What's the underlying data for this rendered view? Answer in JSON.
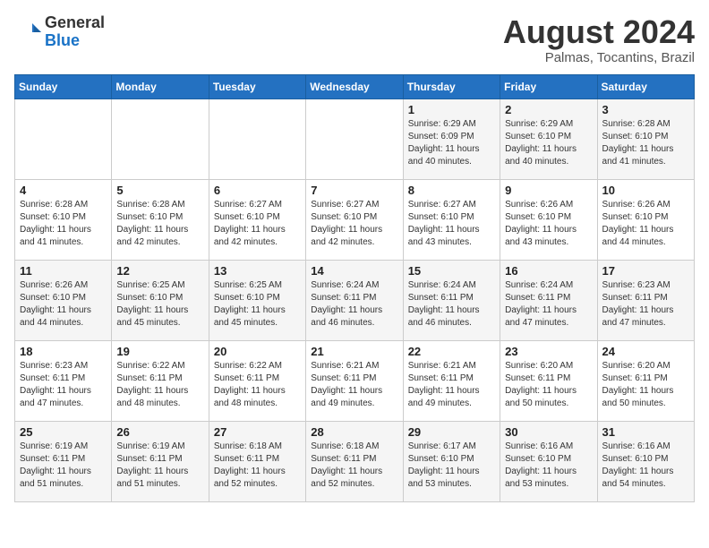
{
  "header": {
    "logo_general": "General",
    "logo_blue": "Blue",
    "month_year": "August 2024",
    "location": "Palmas, Tocantins, Brazil"
  },
  "days_of_week": [
    "Sunday",
    "Monday",
    "Tuesday",
    "Wednesday",
    "Thursday",
    "Friday",
    "Saturday"
  ],
  "weeks": [
    [
      {
        "day": "",
        "sunrise": "",
        "sunset": "",
        "daylight": ""
      },
      {
        "day": "",
        "sunrise": "",
        "sunset": "",
        "daylight": ""
      },
      {
        "day": "",
        "sunrise": "",
        "sunset": "",
        "daylight": ""
      },
      {
        "day": "",
        "sunrise": "",
        "sunset": "",
        "daylight": ""
      },
      {
        "day": "1",
        "sunrise": "Sunrise: 6:29 AM",
        "sunset": "Sunset: 6:09 PM",
        "daylight": "Daylight: 11 hours and 40 minutes."
      },
      {
        "day": "2",
        "sunrise": "Sunrise: 6:29 AM",
        "sunset": "Sunset: 6:10 PM",
        "daylight": "Daylight: 11 hours and 40 minutes."
      },
      {
        "day": "3",
        "sunrise": "Sunrise: 6:28 AM",
        "sunset": "Sunset: 6:10 PM",
        "daylight": "Daylight: 11 hours and 41 minutes."
      }
    ],
    [
      {
        "day": "4",
        "sunrise": "Sunrise: 6:28 AM",
        "sunset": "Sunset: 6:10 PM",
        "daylight": "Daylight: 11 hours and 41 minutes."
      },
      {
        "day": "5",
        "sunrise": "Sunrise: 6:28 AM",
        "sunset": "Sunset: 6:10 PM",
        "daylight": "Daylight: 11 hours and 42 minutes."
      },
      {
        "day": "6",
        "sunrise": "Sunrise: 6:27 AM",
        "sunset": "Sunset: 6:10 PM",
        "daylight": "Daylight: 11 hours and 42 minutes."
      },
      {
        "day": "7",
        "sunrise": "Sunrise: 6:27 AM",
        "sunset": "Sunset: 6:10 PM",
        "daylight": "Daylight: 11 hours and 42 minutes."
      },
      {
        "day": "8",
        "sunrise": "Sunrise: 6:27 AM",
        "sunset": "Sunset: 6:10 PM",
        "daylight": "Daylight: 11 hours and 43 minutes."
      },
      {
        "day": "9",
        "sunrise": "Sunrise: 6:26 AM",
        "sunset": "Sunset: 6:10 PM",
        "daylight": "Daylight: 11 hours and 43 minutes."
      },
      {
        "day": "10",
        "sunrise": "Sunrise: 6:26 AM",
        "sunset": "Sunset: 6:10 PM",
        "daylight": "Daylight: 11 hours and 44 minutes."
      }
    ],
    [
      {
        "day": "11",
        "sunrise": "Sunrise: 6:26 AM",
        "sunset": "Sunset: 6:10 PM",
        "daylight": "Daylight: 11 hours and 44 minutes."
      },
      {
        "day": "12",
        "sunrise": "Sunrise: 6:25 AM",
        "sunset": "Sunset: 6:10 PM",
        "daylight": "Daylight: 11 hours and 45 minutes."
      },
      {
        "day": "13",
        "sunrise": "Sunrise: 6:25 AM",
        "sunset": "Sunset: 6:10 PM",
        "daylight": "Daylight: 11 hours and 45 minutes."
      },
      {
        "day": "14",
        "sunrise": "Sunrise: 6:24 AM",
        "sunset": "Sunset: 6:11 PM",
        "daylight": "Daylight: 11 hours and 46 minutes."
      },
      {
        "day": "15",
        "sunrise": "Sunrise: 6:24 AM",
        "sunset": "Sunset: 6:11 PM",
        "daylight": "Daylight: 11 hours and 46 minutes."
      },
      {
        "day": "16",
        "sunrise": "Sunrise: 6:24 AM",
        "sunset": "Sunset: 6:11 PM",
        "daylight": "Daylight: 11 hours and 47 minutes."
      },
      {
        "day": "17",
        "sunrise": "Sunrise: 6:23 AM",
        "sunset": "Sunset: 6:11 PM",
        "daylight": "Daylight: 11 hours and 47 minutes."
      }
    ],
    [
      {
        "day": "18",
        "sunrise": "Sunrise: 6:23 AM",
        "sunset": "Sunset: 6:11 PM",
        "daylight": "Daylight: 11 hours and 47 minutes."
      },
      {
        "day": "19",
        "sunrise": "Sunrise: 6:22 AM",
        "sunset": "Sunset: 6:11 PM",
        "daylight": "Daylight: 11 hours and 48 minutes."
      },
      {
        "day": "20",
        "sunrise": "Sunrise: 6:22 AM",
        "sunset": "Sunset: 6:11 PM",
        "daylight": "Daylight: 11 hours and 48 minutes."
      },
      {
        "day": "21",
        "sunrise": "Sunrise: 6:21 AM",
        "sunset": "Sunset: 6:11 PM",
        "daylight": "Daylight: 11 hours and 49 minutes."
      },
      {
        "day": "22",
        "sunrise": "Sunrise: 6:21 AM",
        "sunset": "Sunset: 6:11 PM",
        "daylight": "Daylight: 11 hours and 49 minutes."
      },
      {
        "day": "23",
        "sunrise": "Sunrise: 6:20 AM",
        "sunset": "Sunset: 6:11 PM",
        "daylight": "Daylight: 11 hours and 50 minutes."
      },
      {
        "day": "24",
        "sunrise": "Sunrise: 6:20 AM",
        "sunset": "Sunset: 6:11 PM",
        "daylight": "Daylight: 11 hours and 50 minutes."
      }
    ],
    [
      {
        "day": "25",
        "sunrise": "Sunrise: 6:19 AM",
        "sunset": "Sunset: 6:11 PM",
        "daylight": "Daylight: 11 hours and 51 minutes."
      },
      {
        "day": "26",
        "sunrise": "Sunrise: 6:19 AM",
        "sunset": "Sunset: 6:11 PM",
        "daylight": "Daylight: 11 hours and 51 minutes."
      },
      {
        "day": "27",
        "sunrise": "Sunrise: 6:18 AM",
        "sunset": "Sunset: 6:11 PM",
        "daylight": "Daylight: 11 hours and 52 minutes."
      },
      {
        "day": "28",
        "sunrise": "Sunrise: 6:18 AM",
        "sunset": "Sunset: 6:11 PM",
        "daylight": "Daylight: 11 hours and 52 minutes."
      },
      {
        "day": "29",
        "sunrise": "Sunrise: 6:17 AM",
        "sunset": "Sunset: 6:10 PM",
        "daylight": "Daylight: 11 hours and 53 minutes."
      },
      {
        "day": "30",
        "sunrise": "Sunrise: 6:16 AM",
        "sunset": "Sunset: 6:10 PM",
        "daylight": "Daylight: 11 hours and 53 minutes."
      },
      {
        "day": "31",
        "sunrise": "Sunrise: 6:16 AM",
        "sunset": "Sunset: 6:10 PM",
        "daylight": "Daylight: 11 hours and 54 minutes."
      }
    ]
  ]
}
